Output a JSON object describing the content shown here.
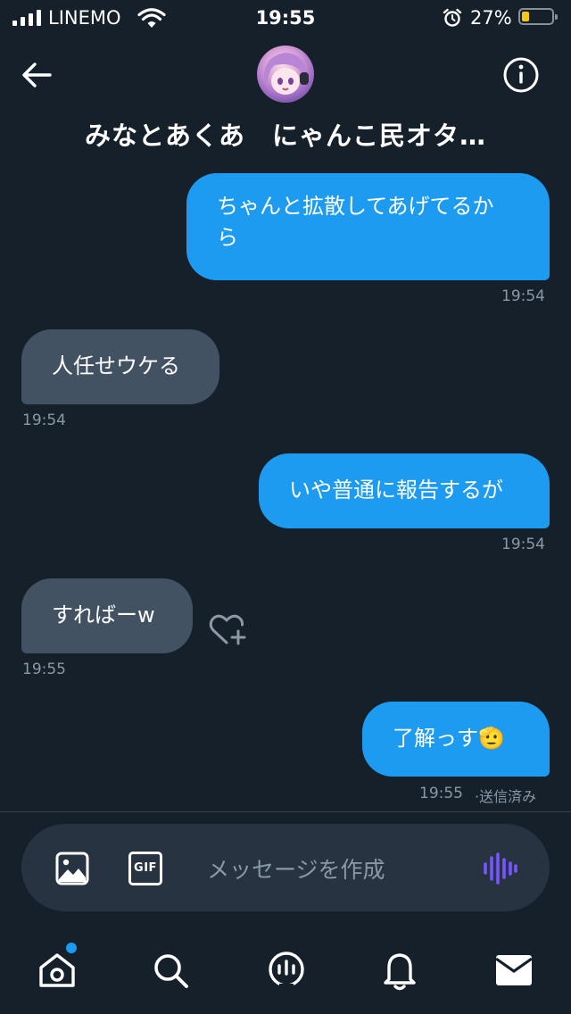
{
  "status_bar": {
    "carrier": "LINEMO",
    "time": "19:55",
    "battery_percent": "27%",
    "battery_level": 0.27
  },
  "header": {
    "title": "みなとあくあ　にゃんこ民オタ…"
  },
  "messages": [
    {
      "direction": "out",
      "lines": [
        "ちゃんと拡散してあげてるか",
        "ら"
      ],
      "time": "19:54"
    },
    {
      "direction": "in",
      "text": "人任せウケる",
      "time": "19:54"
    },
    {
      "direction": "out",
      "text": "いや普通に報告するが",
      "time": "19:54"
    },
    {
      "direction": "in",
      "text": "すればーw",
      "time": "19:55"
    },
    {
      "direction": "out",
      "text": "了解っす",
      "emoji": "🫡",
      "time": "19:55",
      "status": "·送信済み"
    }
  ],
  "composer": {
    "placeholder": "メッセージを作成",
    "gif_label": "GIF"
  },
  "colors": {
    "background": "#15202b",
    "outgoing_bubble": "#1d9bf0",
    "incoming_bubble": "#425262",
    "voice_icon": "#7856ff"
  },
  "nav": {
    "items": [
      "home-icon",
      "search-icon",
      "spaces-icon",
      "notifications-icon",
      "messages-icon"
    ],
    "home_has_badge": true
  }
}
